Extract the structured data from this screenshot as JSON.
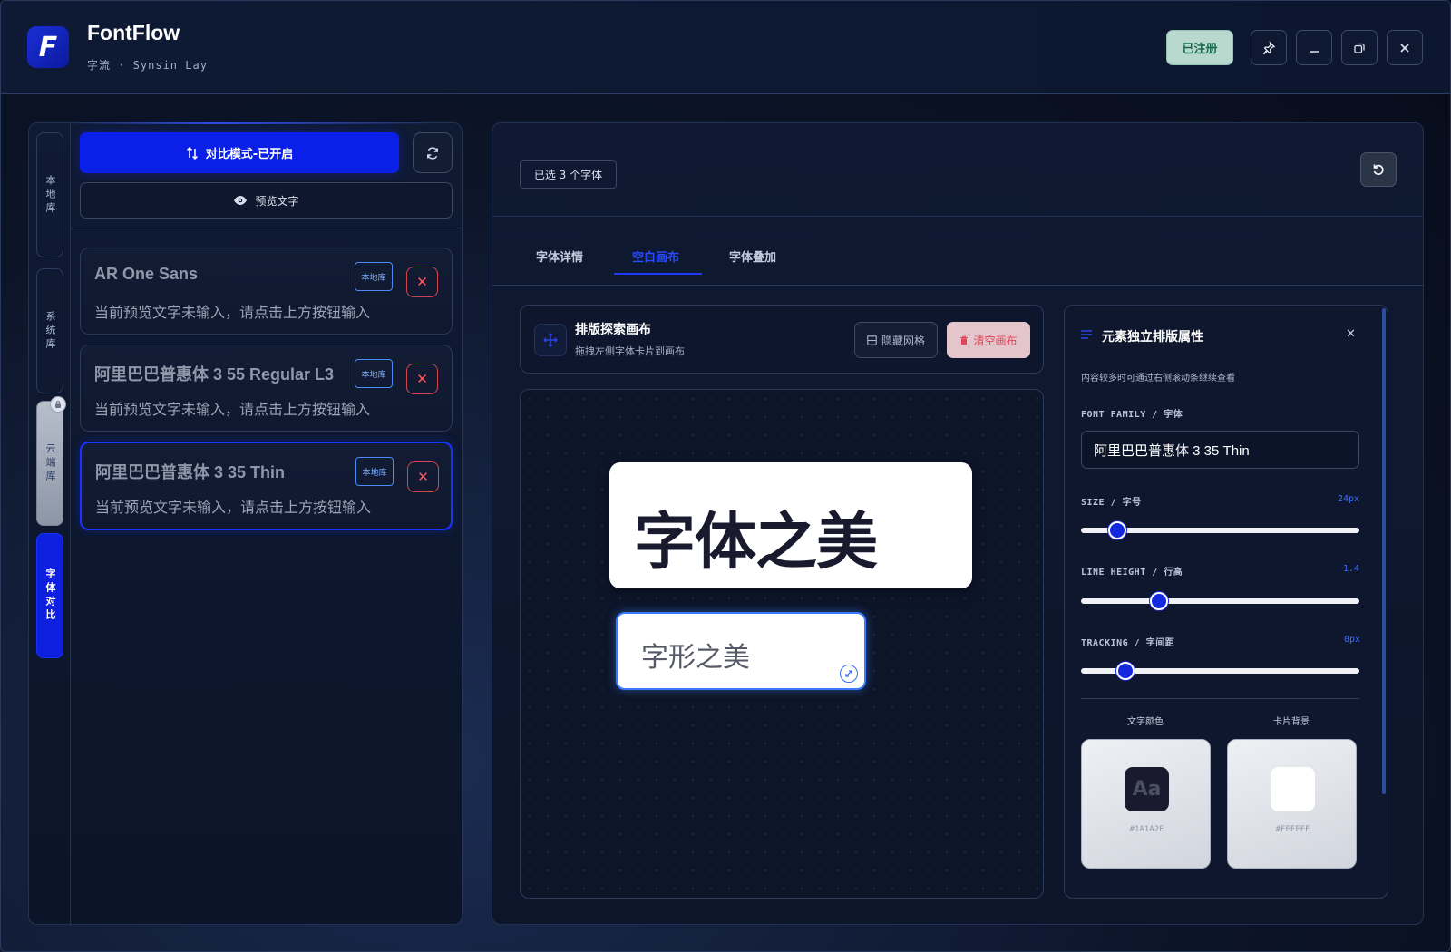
{
  "app": {
    "logo_letter": "F",
    "title": "FontFlow",
    "subtitle": "字流 · Synsin Lay",
    "registered_label": "已注册"
  },
  "window_controls": {
    "pin": "pin-icon",
    "minimize": "minimize-icon",
    "restore": "restore-icon",
    "close": "close-icon"
  },
  "sidebar": {
    "vtabs": [
      {
        "label": "本地库"
      },
      {
        "label": "系统库"
      },
      {
        "label": "云端库"
      },
      {
        "label": "字体对比"
      }
    ],
    "compare_button": "对比模式-已开启",
    "preview_button": "预览文字",
    "fonts": [
      {
        "name": "AR One Sans",
        "preview": "当前预览文字未输入，请点击上方按钮输入",
        "badge": "本地库"
      },
      {
        "name": "阿里巴巴普惠体 3 55 Regular L3",
        "preview": "当前预览文字未输入，请点击上方按钮输入",
        "badge": "本地库"
      },
      {
        "name": "阿里巴巴普惠体 3 35 Thin",
        "preview": "当前预览文字未输入，请点击上方按钮输入",
        "badge": "本地库"
      }
    ]
  },
  "main": {
    "selected_count": "已选 3 个字体",
    "tabs": [
      {
        "label": "字体详情"
      },
      {
        "label": "空白画布"
      },
      {
        "label": "字体叠加"
      }
    ],
    "active_tab": 1,
    "canvas": {
      "title": "排版探索画布",
      "hint": "拖拽左侧字体卡片到画布",
      "hide_grid": "隐藏网格",
      "clear": "清空画布",
      "card1_text": "字体之美",
      "card2_text": "字形之美"
    }
  },
  "properties": {
    "title": "元素独立排版属性",
    "hint": "内容较多时可通过右侧滚动条继续查看",
    "font_family_label": "FONT FAMILY / 字体",
    "font_family_value": "阿里巴巴普惠体 3 35 Thin",
    "size_label": "SIZE / 字号",
    "size_value": "24px",
    "size_fraction": 0.13,
    "line_height_label": "LINE HEIGHT / 行高",
    "line_height_value": "1.4",
    "line_height_fraction": 0.28,
    "tracking_label": "TRACKING / 字间距",
    "tracking_value": "0px",
    "tracking_fraction": 0.16,
    "text_color_label": "文字颜色",
    "card_bg_label": "卡片背景",
    "text_color": "#1A1A2E",
    "text_color_sample": "Aa",
    "card_bg_color": "#FFFFFF"
  }
}
